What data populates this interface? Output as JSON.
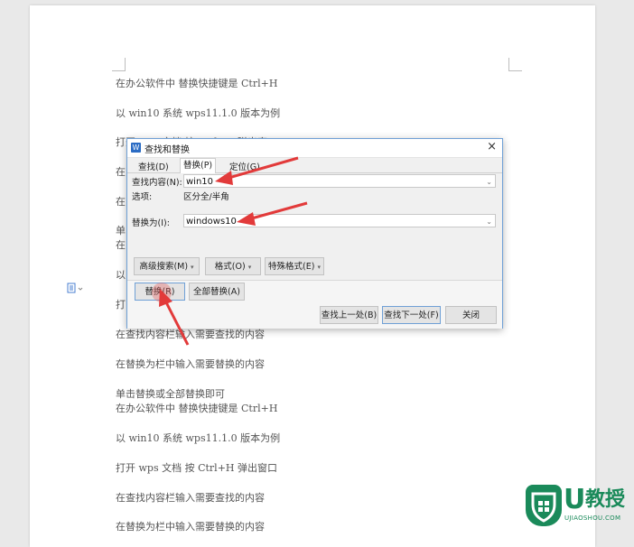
{
  "document": {
    "lines": [
      "在办公软件中   替换快捷键是 Ctrl+H",
      "以 win10 系统   wps11.1.0 版本为例",
      "打开 wps 文档   按 Ctrl+H   弹出窗口",
      "在",
      "在",
      "单",
      "在",
      "以",
      "打",
      "在查找内容栏输入需要查找的内容",
      "在替换为栏中输入需要替换的内容",
      "单击替换或全部替换即可",
      "在办公软件中   替换快捷键是 Ctrl+H",
      "以 win10 系统   wps11.1.0 版本为例",
      "打开 wps 文档   按 Ctrl+H   弹出窗口",
      "在查找内容栏输入需要查找的内容",
      "在替换为栏中输入需要替换的内容"
    ]
  },
  "dialog": {
    "app_icon": "W",
    "title": "查找和替换",
    "close": "×",
    "tabs": [
      "查找(D)",
      "替换(P)",
      "定位(G)"
    ],
    "find_label": "查找内容(N):",
    "find_value": "win10",
    "options_label": "选项:",
    "options_value": "区分全/半角",
    "replace_label": "替换为(I):",
    "replace_value": "windows10",
    "advanced_search": "高级搜索(M)",
    "format": "格式(O)",
    "special_format": "特殊格式(E)",
    "replace_btn": "替换(R)",
    "replace_all_btn": "全部替换(A)",
    "find_prev": "查找上一处(B)",
    "find_next": "查找下一处(F)",
    "close_btn": "关闭"
  },
  "logo": {
    "brand": "U",
    "name": "教授",
    "url": "UJIAOSHOU.COM"
  },
  "colors": {
    "arrow": "#e23a3a",
    "brand": "#1a8a5a",
    "accent": "#2b6cc4"
  }
}
